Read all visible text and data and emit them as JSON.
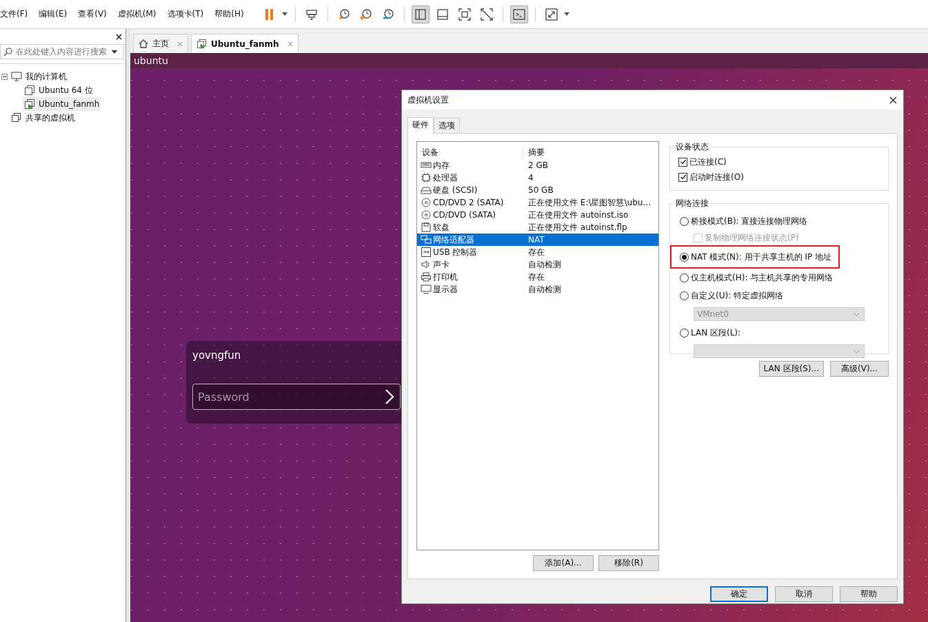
{
  "menu": [
    "文件(F)",
    "编辑(E)",
    "查看(V)",
    "虚拟机(M)",
    "选项卡(T)",
    "帮助(H)"
  ],
  "toolbar": [
    {
      "kind": "pause",
      "pressed": false
    },
    {
      "kind": "caret"
    },
    {
      "kind": "sep"
    },
    {
      "kind": "send-keys",
      "pressed": false
    },
    {
      "kind": "sep"
    },
    {
      "kind": "snapshot-take",
      "pressed": false
    },
    {
      "kind": "snapshot-revert",
      "pressed": false
    },
    {
      "kind": "snapshot-manage",
      "pressed": false
    },
    {
      "kind": "sep"
    },
    {
      "kind": "view-library",
      "pressed": true
    },
    {
      "kind": "view-thumbs",
      "pressed": false
    },
    {
      "kind": "view-full",
      "pressed": false
    },
    {
      "kind": "view-unity",
      "pressed": false
    },
    {
      "kind": "sep"
    },
    {
      "kind": "console",
      "pressed": true
    },
    {
      "kind": "sep"
    },
    {
      "kind": "stretch",
      "pressed": false
    },
    {
      "kind": "caret"
    }
  ],
  "library": {
    "search": {
      "placeholder": "在此处键入内容进行搜索"
    },
    "tree": [
      {
        "label": "我的计算机",
        "kind": "computer",
        "selected": false,
        "expanded": true,
        "children": [
          {
            "label": "Ubuntu 64 位",
            "kind": "vm",
            "running": false,
            "selected": false
          },
          {
            "label": "Ubuntu_fanmh",
            "kind": "vm",
            "running": true,
            "selected": true
          }
        ]
      },
      {
        "label": "共享的虚拟机",
        "kind": "shared",
        "selected": false
      }
    ]
  },
  "tabs": [
    {
      "label": "主页",
      "kind": "home",
      "selected": false
    },
    {
      "label": "Ubuntu_fanmh",
      "kind": "vm",
      "selected": true
    }
  ],
  "vm_screen": {
    "title": "ubuntu",
    "login": {
      "user": "yovngfun",
      "password": {
        "placeholder": "Password"
      }
    }
  },
  "dialog": {
    "title": "虚拟机设置",
    "tabs": [
      {
        "label": "硬件",
        "selected": true
      },
      {
        "label": "选项",
        "selected": false
      }
    ],
    "columns": [
      "设备",
      "摘要"
    ],
    "devices": [
      {
        "kind": "memory",
        "name": "内存",
        "summary": "2 GB",
        "selected": false
      },
      {
        "kind": "cpu",
        "name": "处理器",
        "summary": "4",
        "selected": false
      },
      {
        "kind": "disk",
        "name": "硬盘 (SCSI)",
        "summary": "50 GB",
        "selected": false
      },
      {
        "kind": "cdrom",
        "name": "CD/DVD 2 (SATA)",
        "summary": "正在使用文件 E:\\星图智慧\\ubu…",
        "selected": false
      },
      {
        "kind": "cdrom",
        "name": "CD/DVD (SATA)",
        "summary": "正在使用文件 autoinst.iso",
        "selected": false
      },
      {
        "kind": "floppy",
        "name": "软盘",
        "summary": "正在使用文件 autoinst.flp",
        "selected": false
      },
      {
        "kind": "network",
        "name": "网络适配器",
        "summary": "NAT",
        "selected": true
      },
      {
        "kind": "usb",
        "name": "USB 控制器",
        "summary": "存在",
        "selected": false
      },
      {
        "kind": "sound",
        "name": "声卡",
        "summary": "自动检测",
        "selected": false
      },
      {
        "kind": "printer",
        "name": "打印机",
        "summary": "存在",
        "selected": false
      },
      {
        "kind": "display",
        "name": "显示器",
        "summary": "自动检测",
        "selected": false
      }
    ],
    "list_buttons": [
      "添加(A)...",
      "移除(R)"
    ],
    "device_status": {
      "title": "设备状态",
      "options": [
        {
          "label": "已连接(C)",
          "checked": true
        },
        {
          "label": "启动时连接(O)",
          "checked": true
        }
      ]
    },
    "network": {
      "title": "网络连接",
      "options": [
        {
          "kind": "radio",
          "label": "桥接模式(B): 直接连接物理网络",
          "selected": false,
          "highlighted": false
        },
        {
          "kind": "checkbox",
          "label": "复制物理网络连接状态(P)",
          "checked": false,
          "disabled": true
        },
        {
          "kind": "radio",
          "label": "NAT 模式(N): 用于共享主机的 IP 地址",
          "selected": true,
          "highlighted": true
        },
        {
          "kind": "radio",
          "label": "仅主机模式(H): 与主机共享的专用网络",
          "selected": false,
          "highlighted": false
        },
        {
          "kind": "radio",
          "label": "自定义(U): 特定虚拟网络",
          "selected": false,
          "highlighted": false
        },
        {
          "kind": "select",
          "value": "VMnet0",
          "disabled": true
        },
        {
          "kind": "radio",
          "label": "LAN 区段(L):",
          "selected": false,
          "highlighted": false
        },
        {
          "kind": "select",
          "disabled": true
        }
      ],
      "buttons": [
        "LAN 区段(S)...",
        "高级(V)..."
      ]
    },
    "footer_buttons": [
      {
        "label": "确定",
        "default": true
      },
      {
        "label": "取消",
        "default": false
      },
      {
        "label": "帮助",
        "default": false
      }
    ]
  }
}
